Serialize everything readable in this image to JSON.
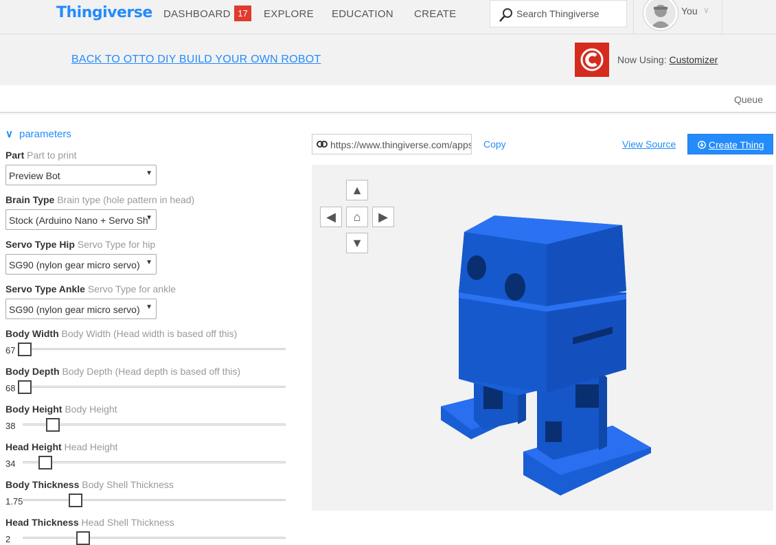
{
  "nav": {
    "logo": "Thingiverse",
    "dashboard": "DASHBOARD",
    "dashboard_badge": "17",
    "explore": "EXPLORE",
    "education": "EDUCATION",
    "create": "CREATE",
    "search_placeholder": "Search Thingiverse",
    "user_label": "You"
  },
  "backbar": {
    "back_link": "BACK TO OTTO DIY BUILD YOUR OWN ROBOT",
    "now_using_label": "Now Using:",
    "app_name": "Customizer"
  },
  "queue_label": "Queue",
  "params": {
    "heading": "parameters",
    "fields": [
      {
        "label": "Part",
        "hint": "Part to print",
        "type": "select",
        "value": "Preview Bot"
      },
      {
        "label": "Brain Type",
        "hint": "Brain type (hole pattern in head)",
        "type": "select",
        "value": "Stock (Arduino Nano + Servo Sh"
      },
      {
        "label": "Servo Type Hip",
        "hint": "Servo Type for hip",
        "type": "select",
        "value": "SG90 (nylon gear micro servo)"
      },
      {
        "label": "Servo Type Ankle",
        "hint": "Servo Type for ankle",
        "type": "select",
        "value": "SG90 (nylon gear micro servo)"
      },
      {
        "label": "Body Width",
        "hint": "Body Width (Head width is based off this)",
        "type": "slider",
        "value": "67",
        "fraction": 0.0
      },
      {
        "label": "Body Depth",
        "hint": "Body Depth (Head depth is based off this)",
        "type": "slider",
        "value": "68",
        "fraction": 0.0
      },
      {
        "label": "Body Height",
        "hint": "Body Height",
        "type": "slider",
        "value": "38",
        "fraction": 0.11
      },
      {
        "label": "Head Height",
        "hint": "Head Height",
        "type": "slider",
        "value": "34",
        "fraction": 0.08
      },
      {
        "label": "Body Thickness",
        "hint": "Body Shell Thickness",
        "type": "slider",
        "value": "1.75",
        "fraction": 0.2
      },
      {
        "label": "Head Thickness",
        "hint": "Head Shell Thickness",
        "type": "slider",
        "value": "2",
        "fraction": 0.23
      }
    ]
  },
  "toolbar": {
    "share_url": "https://www.thingiverse.com/apps/customizer/run?thing_id=",
    "copy": "Copy",
    "view_source": "View Source",
    "create_thing": "Create Thing"
  },
  "colors": {
    "brand": "#248bfb",
    "model": "#1560d8",
    "badge": "#e03b2f"
  }
}
